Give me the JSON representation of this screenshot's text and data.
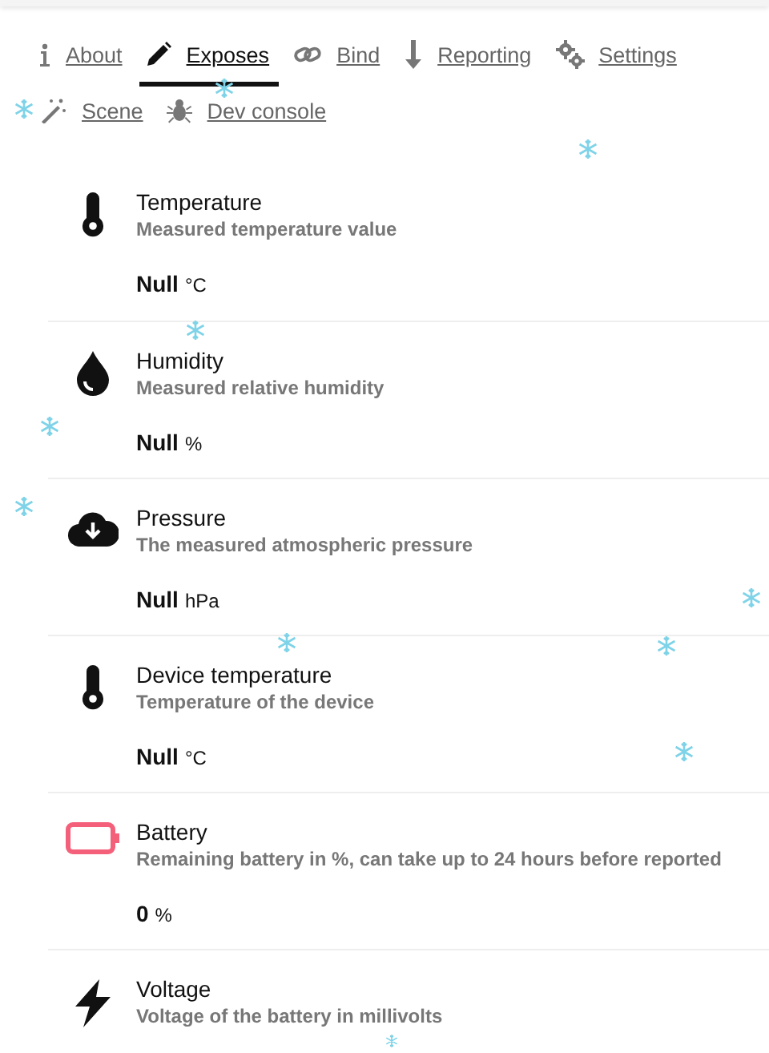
{
  "tabs": [
    {
      "label": "About",
      "kind": "info",
      "selected": false
    },
    {
      "label": "Exposes",
      "kind": "pencil",
      "selected": true
    },
    {
      "label": "Bind",
      "kind": "link",
      "selected": false
    },
    {
      "label": "Reporting",
      "kind": "download",
      "selected": false
    },
    {
      "label": "Settings",
      "kind": "gears",
      "selected": false
    },
    {
      "label": "Scene",
      "kind": "wand",
      "selected": false
    },
    {
      "label": "Dev console",
      "kind": "bug",
      "selected": false
    }
  ],
  "exposes": [
    {
      "kind": "temperature",
      "name": "Temperature",
      "description": "Measured temperature value",
      "value": "Null",
      "unit": "°C"
    },
    {
      "kind": "humidity",
      "name": "Humidity",
      "description": "Measured relative humidity",
      "value": "Null",
      "unit": "%"
    },
    {
      "kind": "pressure",
      "name": "Pressure",
      "description": "The measured atmospheric pressure",
      "value": "Null",
      "unit": "hPa"
    },
    {
      "kind": "temperature",
      "name": "Device temperature",
      "description": "Temperature of the device",
      "value": "Null",
      "unit": "°C"
    },
    {
      "kind": "battery",
      "name": "Battery",
      "description": "Remaining battery in %, can take up to 24 hours before reported",
      "value": "0",
      "unit": "%"
    },
    {
      "kind": "voltage",
      "name": "Voltage",
      "description": "Voltage of the battery in millivolts"
    }
  ]
}
